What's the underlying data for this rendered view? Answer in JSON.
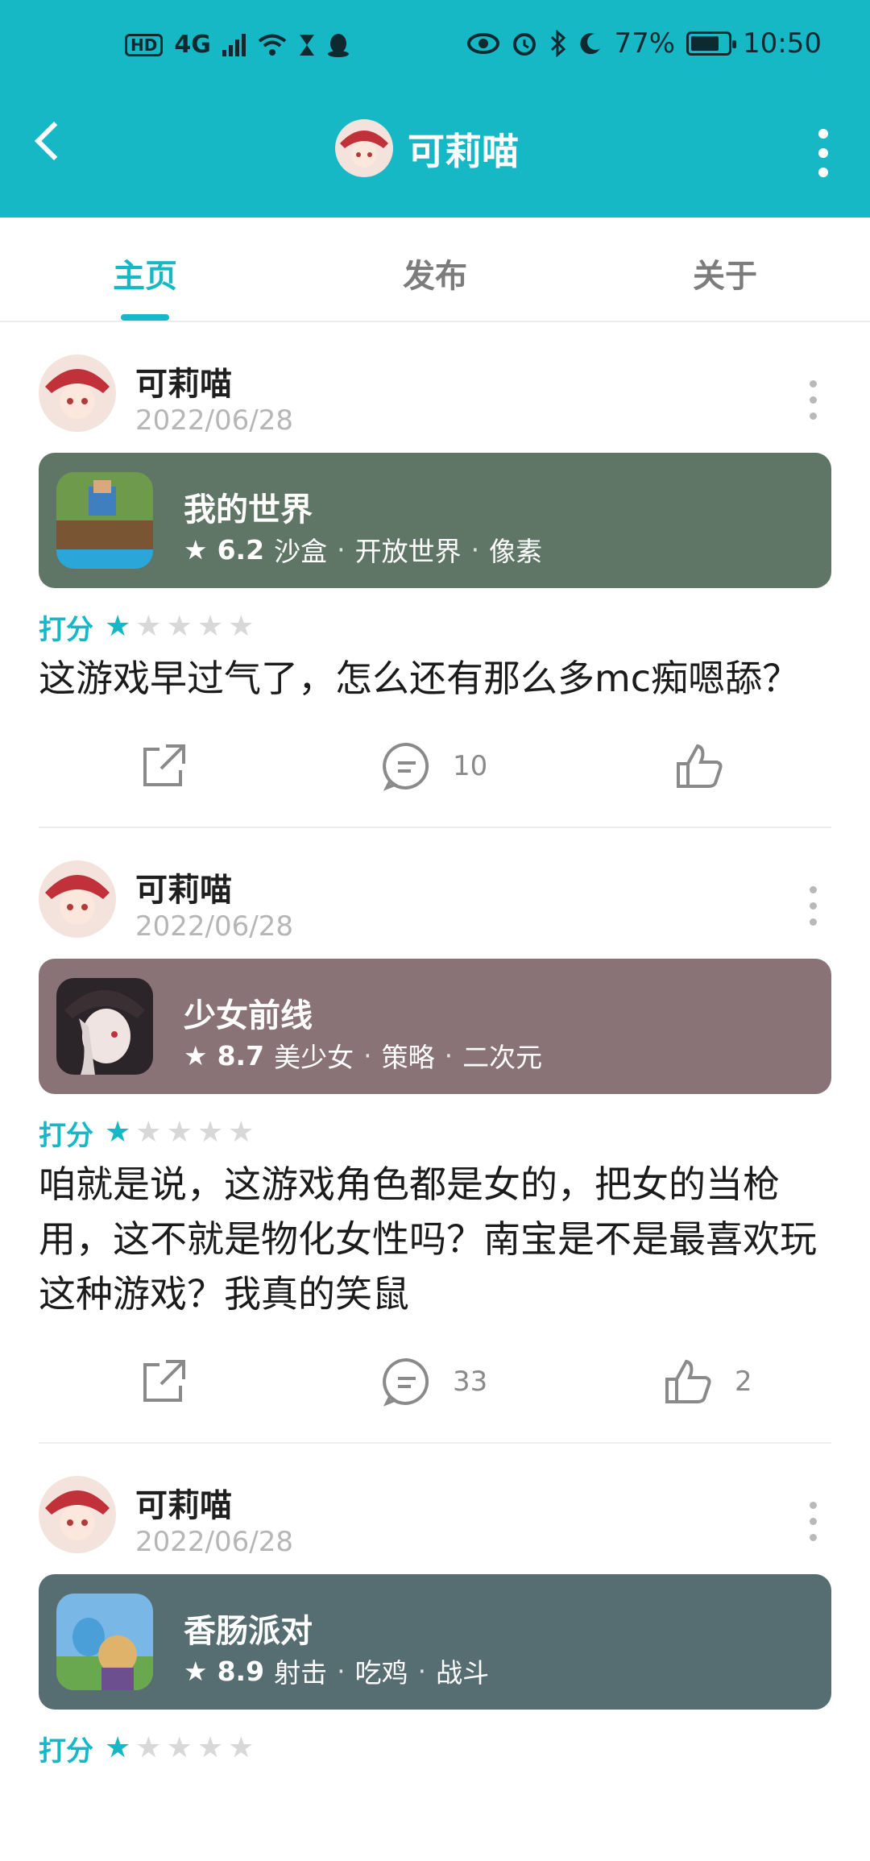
{
  "status_bar": {
    "left_badges": [
      "HD",
      "4G"
    ],
    "battery": "77%",
    "time": "10:50"
  },
  "header": {
    "title": "可莉喵",
    "back_icon": "back-arrow-icon",
    "more_icon": "more-vertical-icon"
  },
  "tabs": [
    {
      "label": "主页",
      "active": true
    },
    {
      "label": "发布",
      "active": false
    },
    {
      "label": "关于",
      "active": false
    }
  ],
  "posts": [
    {
      "user": "可莉喵",
      "date": "2022/06/28",
      "game": {
        "name": "我的世界",
        "score": "6.2",
        "tags": [
          "沙盒",
          "开放世界",
          "像素"
        ],
        "color": "#5f7666"
      },
      "rating_label": "打分",
      "stars": 1,
      "content": "这游戏早过气了，怎么还有那么多mc痴嗯舔？",
      "comments": "10",
      "likes": ""
    },
    {
      "user": "可莉喵",
      "date": "2022/06/28",
      "game": {
        "name": "少女前线",
        "score": "8.7",
        "tags": [
          "美少女",
          "策略",
          "二次元"
        ],
        "color": "#8a7376"
      },
      "rating_label": "打分",
      "stars": 1,
      "content": "咱就是说，这游戏角色都是女的，把女的当枪用，这不就是物化女性吗？南宝是不是最喜欢玩这种游戏？我真的笑鼠",
      "comments": "33",
      "likes": "2"
    },
    {
      "user": "可莉喵",
      "date": "2022/06/28",
      "game": {
        "name": "香肠派对",
        "score": "8.9",
        "tags": [
          "射击",
          "吃鸡",
          "战斗"
        ],
        "color": "#566e72"
      },
      "rating_label": "打分",
      "stars": 1,
      "content": "",
      "comments": "",
      "likes": ""
    }
  ],
  "colors": {
    "accent": "#17b8c6",
    "header_bg": "#17b8c6"
  }
}
